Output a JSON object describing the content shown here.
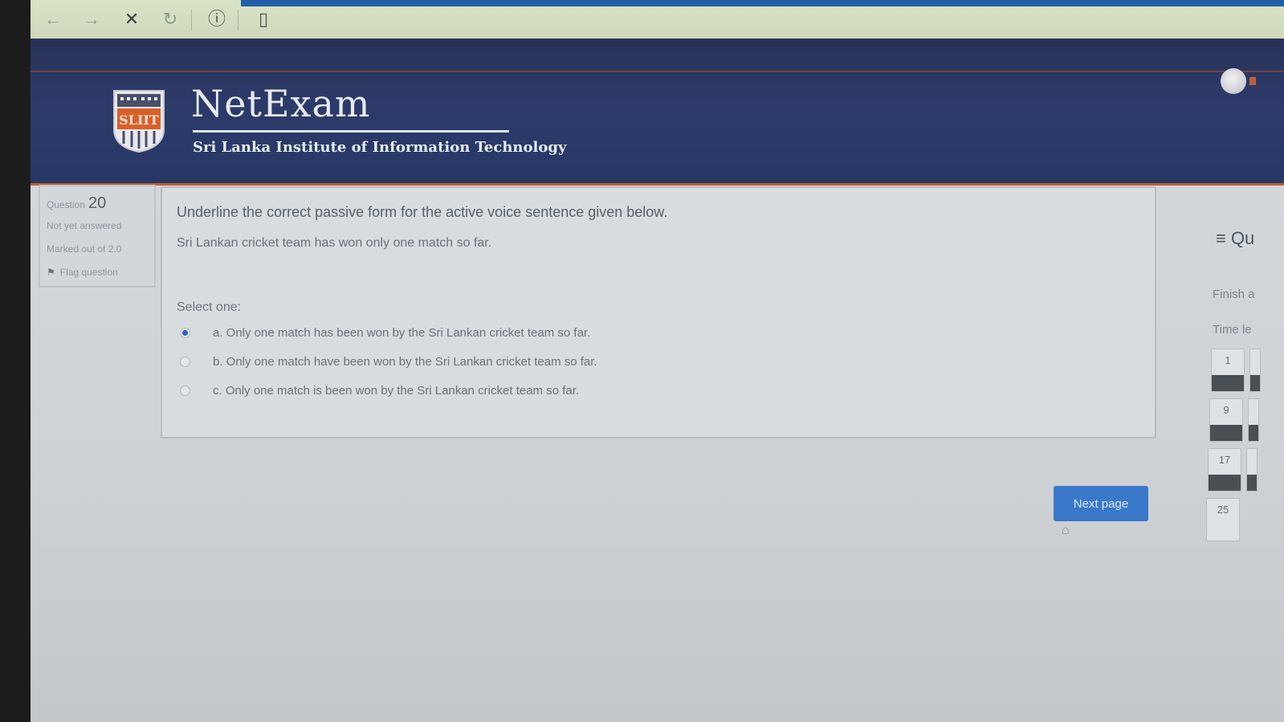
{
  "browser": {
    "back_icon": "←",
    "forward_icon": "→",
    "stop_icon": "✕",
    "reload_icon": "↻",
    "info_icon": "ⓘ",
    "reader_icon": "▯"
  },
  "header": {
    "brand_name": "NetExam",
    "brand_subtitle": "Sri Lanka Institute of Information Technology",
    "logo_text": "SLIIT"
  },
  "question_info": {
    "number_label": "Question",
    "number": "20",
    "state": "Not yet answered",
    "marks": "Marked out of 2.0",
    "flag_label": "Flag question"
  },
  "question": {
    "text": "Underline the correct passive form for the active voice sentence given below.",
    "sentence": "Sri Lankan cricket team has won only one match so far.",
    "select_label": "Select one:",
    "options": [
      {
        "label": "a. Only one match has been won by the Sri Lankan cricket team so far.",
        "selected": true
      },
      {
        "label": "b. Only one match have been won by the Sri Lankan cricket team so far.",
        "selected": false
      },
      {
        "label": "c. Only one match is been won by the Sri Lankan cricket team so far.",
        "selected": false
      }
    ]
  },
  "next_button": "Next page",
  "nav_panel": {
    "title": "≡ Qu",
    "finish_label": "Finish a",
    "time_label": "Time le",
    "tiles": [
      "1",
      "9",
      "17",
      "25"
    ]
  },
  "colors": {
    "header_bg": "#2c3a6a",
    "header_accent": "#c25a2a",
    "button_bg": "#3a78c9"
  }
}
